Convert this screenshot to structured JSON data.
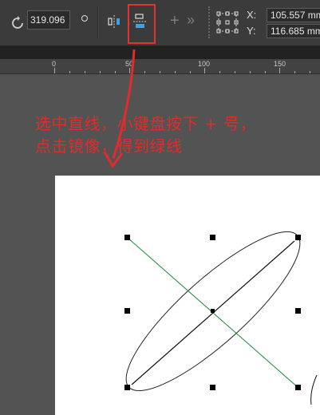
{
  "toolbar": {
    "rotation_angle": "319.096",
    "x_label": "X:",
    "y_label": "Y:",
    "x_value": "105.557 mm",
    "y_value": "116.685 mm"
  },
  "ruler": {
    "ticks": [
      "0",
      "50",
      "100",
      "150"
    ]
  },
  "annotation": {
    "line1": "选中直线，小键盘按下 + 号，",
    "line2": "点击镜像，得到绿线"
  },
  "colors": {
    "highlight": "#e5312f",
    "annotation_text": "#e22b2b",
    "mirrored_line": "#1a8a3a"
  }
}
